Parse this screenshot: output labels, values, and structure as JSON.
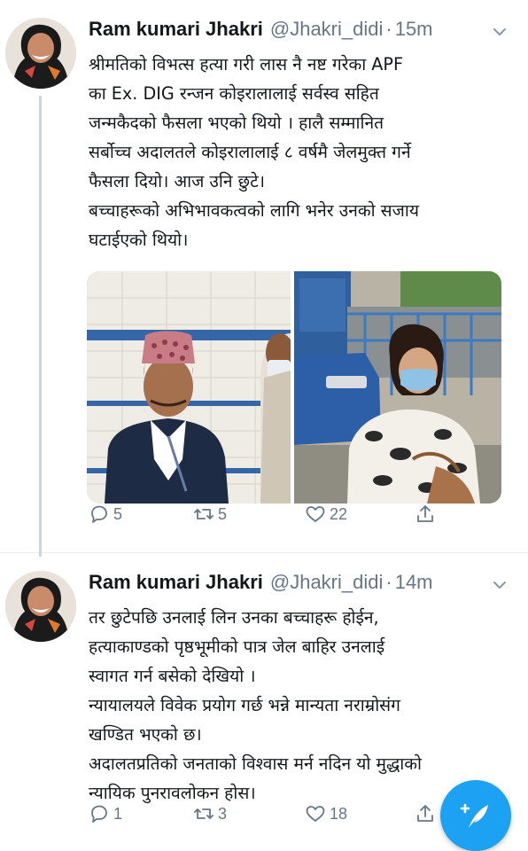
{
  "tweets": [
    {
      "name": "Ram kumari Jhakri",
      "handle": "@Jhakri_didi",
      "separator": "·",
      "time": "15m",
      "lines": [
        "श्रीमतिको विभत्स हत्या गरी लास नै नष्ट गरेका APF",
        "का Ex. DIG रन्जन कोइरालालाई सर्वस्व सहित",
        "जन्मकैदको फैसला भएको थियो । हालै सम्मानित",
        "सर्बोच्च अदालतले कोइरालालाई ८ वर्षमै जेलमुक्त गर्ने",
        "फैसला दियो। आज उनि छुटे।",
        "बच्चाहरूको अभिभावकत्वको लागि भनेर उनको सजाय",
        "घटाईएको थियो।"
      ],
      "replies": "5",
      "retweets": "5",
      "likes": "22"
    },
    {
      "name": "Ram kumari Jhakri",
      "handle": "@Jhakri_didi",
      "separator": "·",
      "time": "14m",
      "lines": [
        "तर छुटेपछि उनलाई लिन उनका बच्चाहरू होईन,",
        "हत्याकाण्डको पृष्ठभूमीको पात्र जेल बाहिर उनलाई",
        "स्वागत गर्न बसेको देखियो ।",
        "न्यायालयले विवेक प्रयोग गर्छ भन्ने मान्यता नराम्रोसंग",
        "खण्डित भएको छ।",
        "अदालतप्रतिको जनताको विश्वास मर्न नदिन यो मुद्धाको",
        "न्यायिक पुनरावलोकन होस।"
      ],
      "replies": "1",
      "retweets": "3",
      "likes": "18"
    }
  ],
  "icons": {
    "reply": "reply-icon",
    "retweet": "retweet-icon",
    "like": "heart-icon",
    "share": "share-icon",
    "more": "chevron-down-icon",
    "compose": "compose-tweet-icon"
  },
  "colors": {
    "accent": "#1da1f2",
    "secondary_text": "#657786",
    "primary_text": "#14171a",
    "divider": "#e6ecf0"
  }
}
